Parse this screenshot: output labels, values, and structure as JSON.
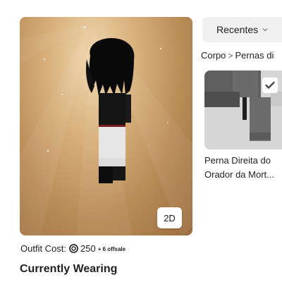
{
  "avatar_preview": {
    "view_toggle_label": "2D",
    "background_color": "#c49a65"
  },
  "outfit": {
    "cost_label": "Outfit Cost:",
    "cost_icon": "robux-icon",
    "cost_value": "250",
    "offsale_label": "+ 6 offsale"
  },
  "currently_wearing": {
    "title": "Currently Wearing"
  },
  "filter": {
    "sort_label": "Recentes",
    "sort_icon": "chevron-down-icon"
  },
  "breadcrumb": {
    "items": [
      "Corpo",
      "Pernas di"
    ],
    "separator": ">"
  },
  "items": [
    {
      "name_line1": "Perna Direita do",
      "name_line2": "Orador da Mort...",
      "selected": true,
      "selected_icon": "check-icon"
    }
  ]
}
